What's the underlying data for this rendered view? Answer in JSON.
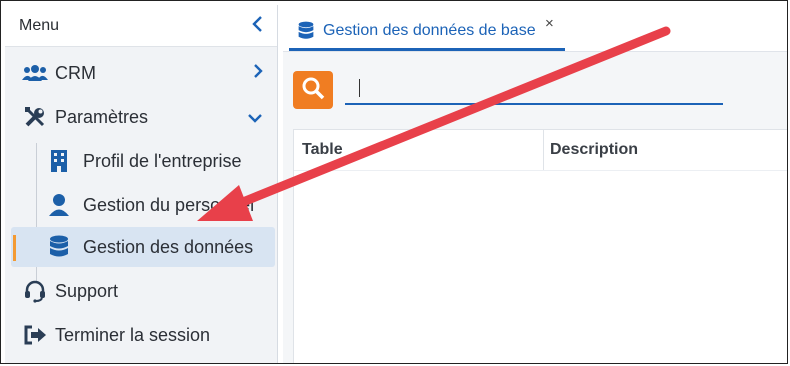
{
  "sidebar": {
    "menu_label": "Menu",
    "items": [
      {
        "label": "CRM",
        "icon": "users-icon"
      },
      {
        "label": "Paramètres",
        "icon": "tools-icon"
      },
      {
        "label": "Profil de l'entreprise",
        "icon": "building-icon"
      },
      {
        "label": "Gestion du personnel",
        "icon": "person-icon"
      },
      {
        "label": "Gestion des données",
        "icon": "database-icon"
      },
      {
        "label": "Support",
        "icon": "headset-icon"
      },
      {
        "label": "Terminer la session",
        "icon": "logout-icon"
      }
    ]
  },
  "tab": {
    "label": "Gestion des données de base",
    "close": "×"
  },
  "search": {
    "placeholder": ""
  },
  "table": {
    "columns": [
      "Table",
      "Description"
    ]
  },
  "colors": {
    "accent": "#1c63b7",
    "search": "#f07d22",
    "arrow": "#e8404a",
    "active_bar": "#f39a33"
  }
}
